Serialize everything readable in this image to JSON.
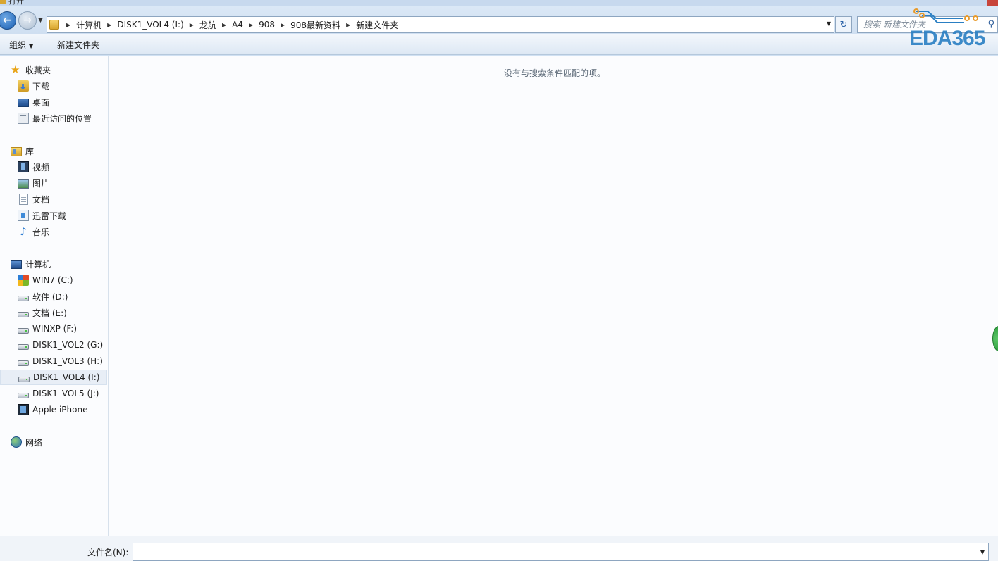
{
  "window": {
    "title": "打开"
  },
  "address_bar": {
    "breadcrumbs": [
      "计算机",
      "DISK1_VOL4 (I:)",
      "龙航",
      "A4",
      "908",
      "908最新资料",
      "新建文件夹"
    ]
  },
  "search": {
    "placeholder": "搜索 新建文件夹"
  },
  "toolbar": {
    "organize_label": "组织",
    "new_folder_label": "新建文件夹"
  },
  "watermark": {
    "text": "EDA365"
  },
  "nav": {
    "favorites": {
      "label": "收藏夹",
      "items": [
        "下载",
        "桌面",
        "最近访问的位置"
      ]
    },
    "libraries": {
      "label": "库",
      "items": [
        "视频",
        "图片",
        "文档",
        "迅雷下载",
        "音乐"
      ]
    },
    "computer": {
      "label": "计算机",
      "items": [
        "WIN7 (C:)",
        "软件 (D:)",
        "文档 (E:)",
        "WINXP (F:)",
        "DISK1_VOL2 (G:)",
        "DISK1_VOL3 (H:)",
        "DISK1_VOL4 (I:)",
        "DISK1_VOL5 (J:)",
        "Apple iPhone"
      ],
      "selected": "DISK1_VOL4 (I:)"
    },
    "network": {
      "label": "网络"
    }
  },
  "content": {
    "empty_message": "没有与搜索条件匹配的项。"
  },
  "filename": {
    "label": "文件名(N):",
    "value": ""
  },
  "colors": {
    "accent": "#1a5fb4",
    "selection": "#e8eef6",
    "pane_bg": "#fbfcfe"
  }
}
